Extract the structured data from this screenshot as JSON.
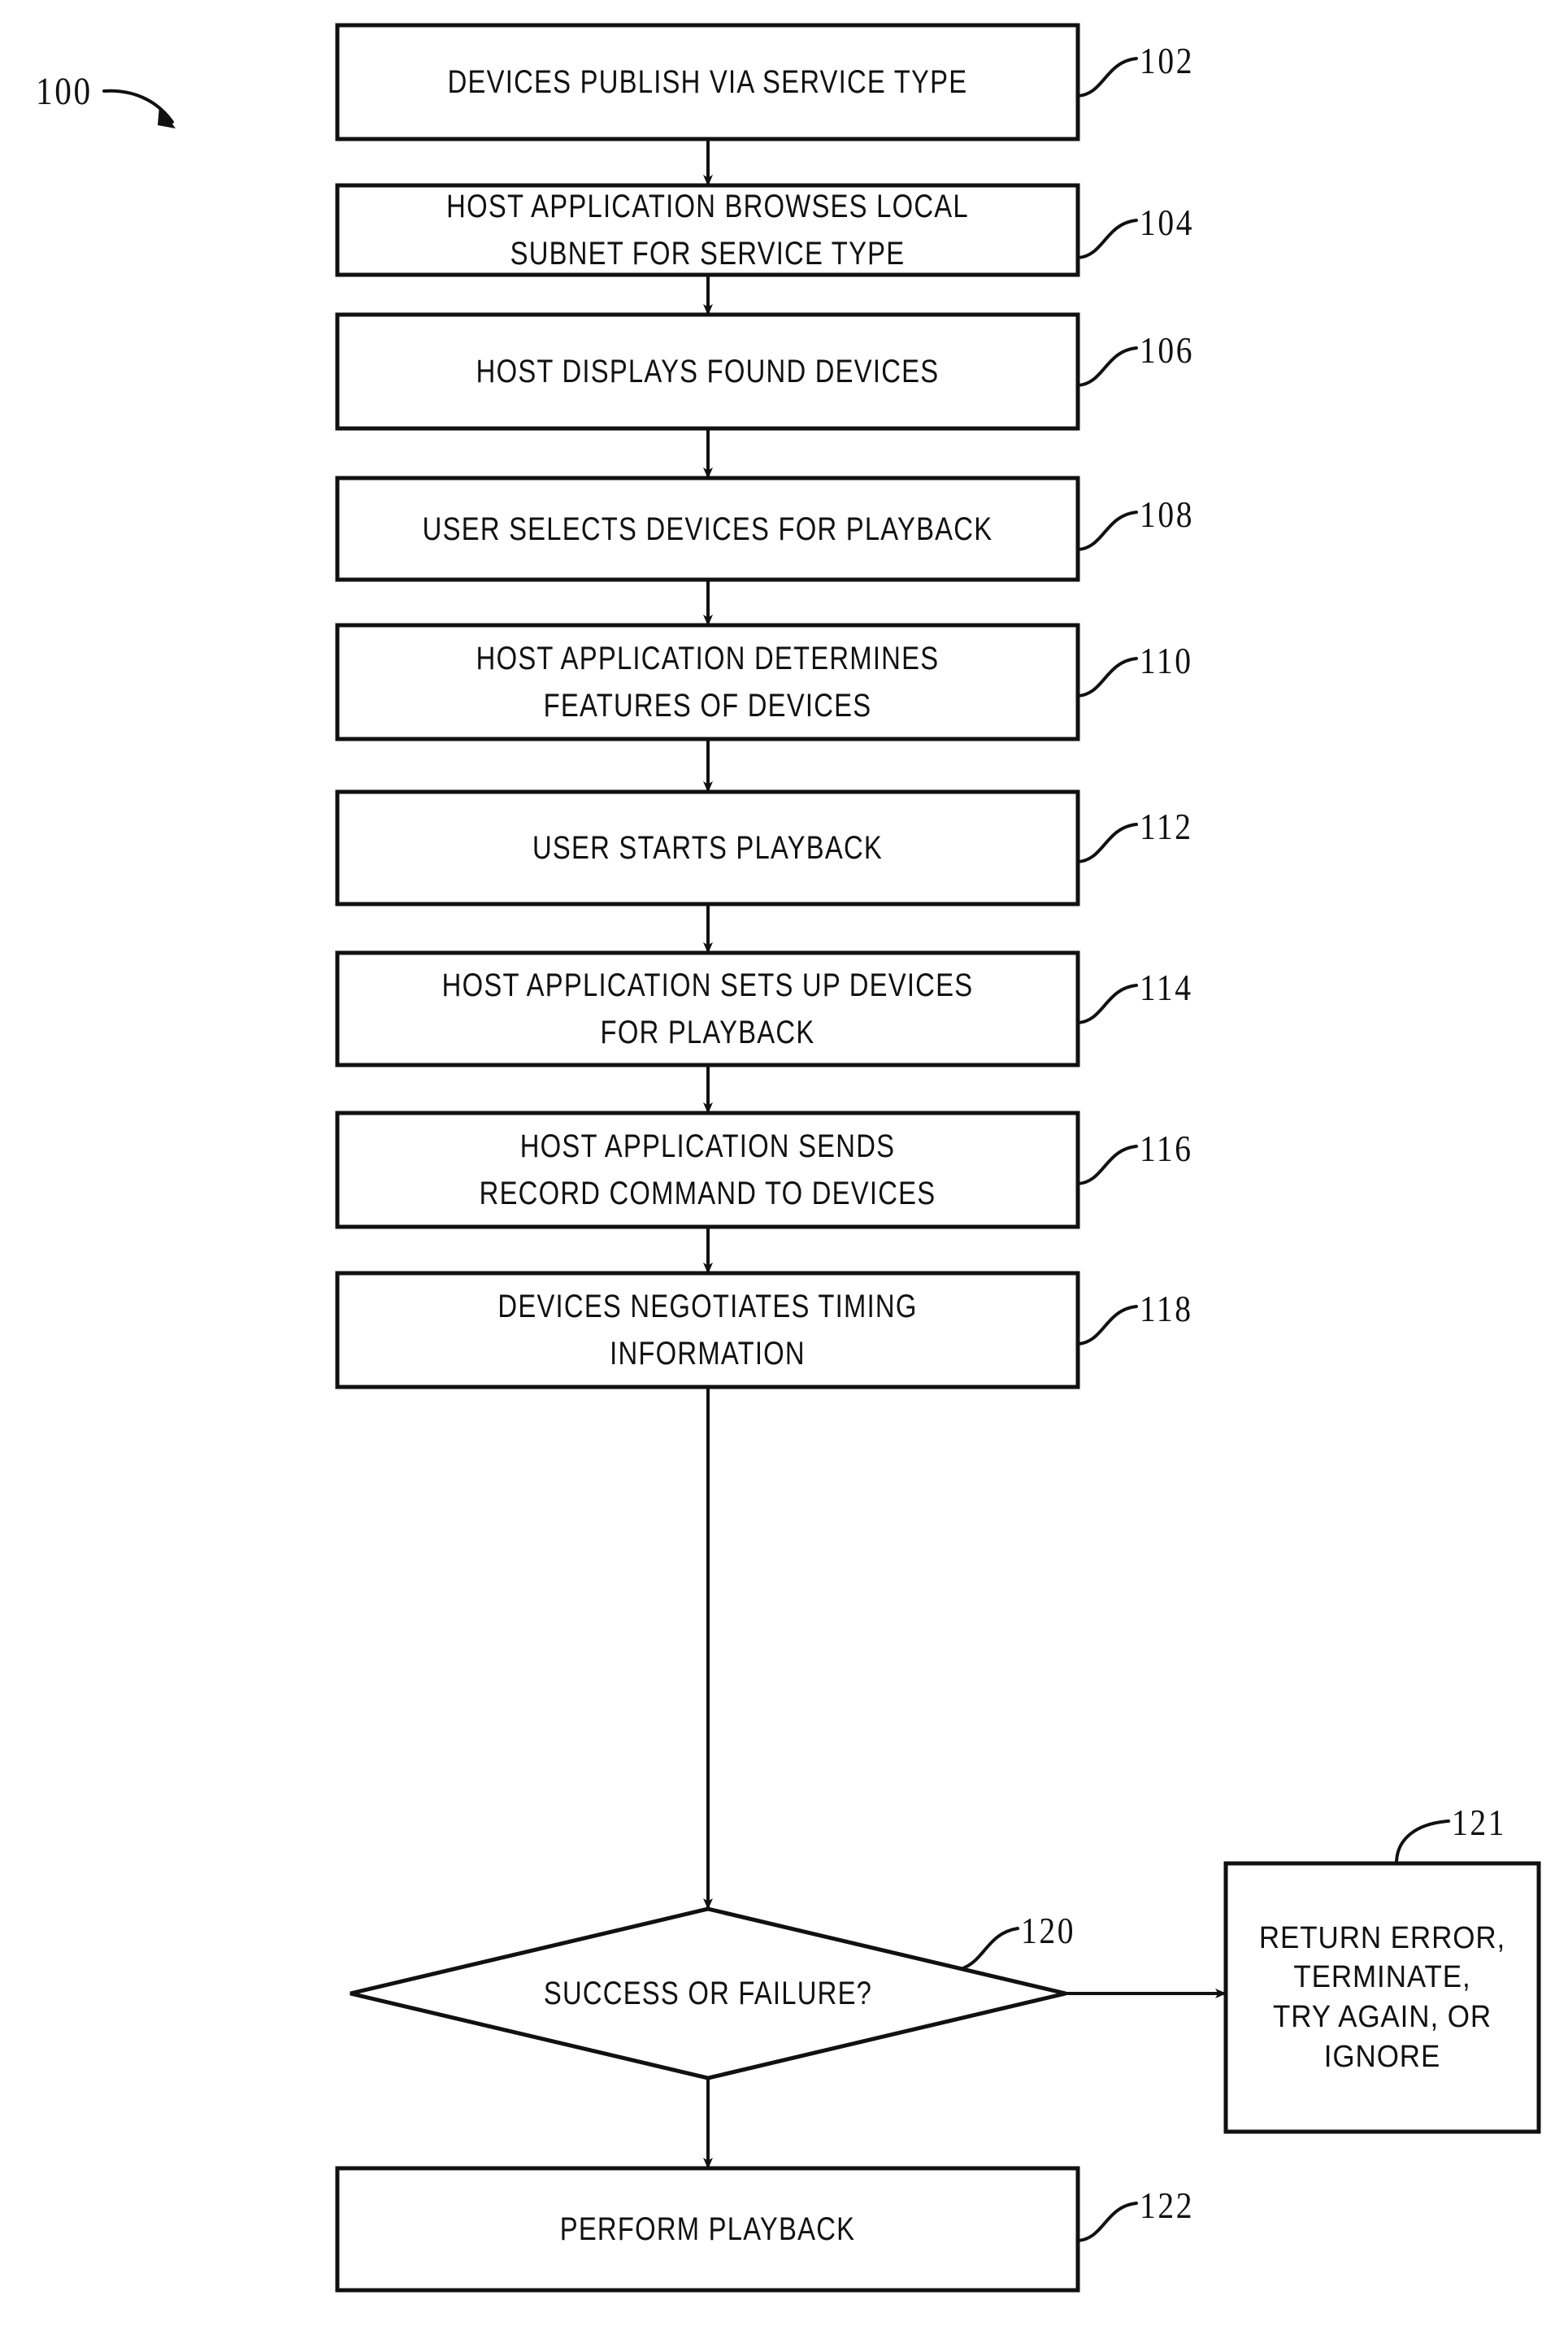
{
  "figure": {
    "figure_number": "100",
    "nodes": [
      {
        "id": "n102",
        "ref": "102",
        "shape": "process",
        "lines": [
          "DEVICES PUBLISH VIA SERVICE TYPE"
        ]
      },
      {
        "id": "n104",
        "ref": "104",
        "shape": "process",
        "lines": [
          "HOST APPLICATION BROWSES LOCAL",
          "SUBNET FOR SERVICE TYPE"
        ]
      },
      {
        "id": "n106",
        "ref": "106",
        "shape": "process",
        "lines": [
          "HOST DISPLAYS FOUND DEVICES"
        ]
      },
      {
        "id": "n108",
        "ref": "108",
        "shape": "process",
        "lines": [
          "USER SELECTS DEVICES FOR PLAYBACK"
        ]
      },
      {
        "id": "n110",
        "ref": "110",
        "shape": "process",
        "lines": [
          "HOST APPLICATION DETERMINES",
          "FEATURES OF DEVICES"
        ]
      },
      {
        "id": "n112",
        "ref": "112",
        "shape": "process",
        "lines": [
          "USER STARTS PLAYBACK"
        ]
      },
      {
        "id": "n114",
        "ref": "114",
        "shape": "process",
        "lines": [
          "HOST APPLICATION SETS UP DEVICES",
          "FOR PLAYBACK"
        ]
      },
      {
        "id": "n116",
        "ref": "116",
        "shape": "process",
        "lines": [
          "HOST APPLICATION SENDS",
          "RECORD COMMAND TO DEVICES"
        ]
      },
      {
        "id": "n118",
        "ref": "118",
        "shape": "process",
        "lines": [
          "DEVICES NEGOTIATES TIMING",
          "INFORMATION"
        ]
      },
      {
        "id": "n120",
        "ref": "120",
        "shape": "decision",
        "lines": [
          "SUCCESS OR FAILURE?"
        ]
      },
      {
        "id": "n121",
        "ref": "121",
        "shape": "process",
        "lines": [
          "RETURN ERROR,",
          "TERMINATE,",
          "TRY AGAIN, OR",
          "IGNORE"
        ]
      },
      {
        "id": "n122",
        "ref": "122",
        "shape": "process",
        "lines": [
          "PERFORM PLAYBACK"
        ]
      }
    ],
    "colors": {
      "ink": "#111111",
      "background": "#ffffff"
    }
  }
}
